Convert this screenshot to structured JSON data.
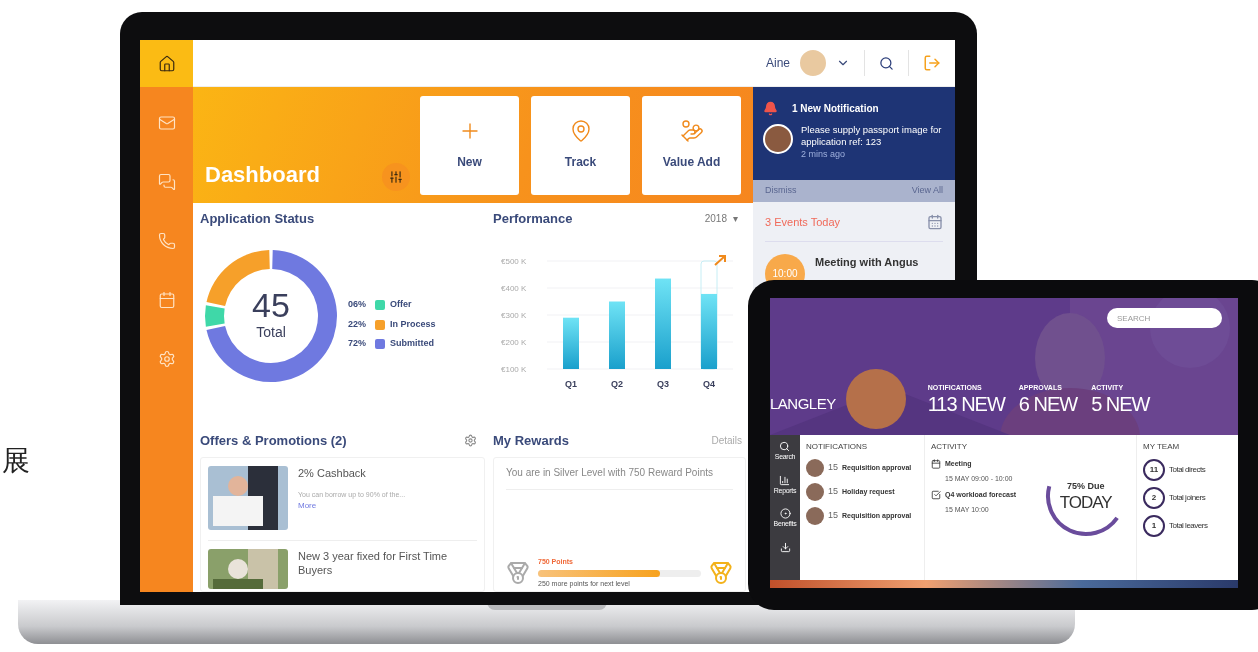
{
  "side_character": "展",
  "laptop": {
    "sidebar": [
      {
        "kind": "home",
        "selected": true
      },
      {
        "kind": "mail",
        "selected": false
      },
      {
        "kind": "chat",
        "selected": false
      },
      {
        "kind": "phone",
        "selected": false
      },
      {
        "kind": "calendar",
        "selected": false
      },
      {
        "kind": "settings",
        "selected": false
      }
    ],
    "topbar": {
      "user": "Aine"
    },
    "banner": {
      "title": "Dashboard",
      "tiles": [
        {
          "kind": "plus",
          "label": "New"
        },
        {
          "kind": "pin",
          "label": "Track"
        },
        {
          "kind": "hand",
          "label": "Value Add"
        }
      ]
    },
    "notification": {
      "heading": "1 New Notification",
      "message": "Please supply passport image for application ref: 123",
      "time": "2 mins ago",
      "actions": [
        "Dismiss",
        "View All"
      ]
    },
    "events": {
      "heading": "3 Events Today",
      "items": [
        {
          "time": "10:00",
          "title": "Meeting with Angus"
        }
      ]
    },
    "application_status": {
      "title": "Application Status",
      "total": "45",
      "total_label": "Total",
      "chart_data": {
        "type": "donut",
        "categories": [
          "Offer",
          "In Process",
          "Submitted"
        ],
        "values": [
          6,
          22,
          72
        ]
      },
      "legend": [
        {
          "percent": "06%",
          "color": "#3fd8a8"
        },
        {
          "percent": "22%",
          "color": "#f6a02a"
        },
        {
          "percent": "72%",
          "color": "#6f79e0"
        }
      ]
    },
    "performance": {
      "title": "Performance",
      "year": "2018",
      "year_caret": "▾",
      "chart_data": {
        "type": "bar",
        "categories": [
          "Q1",
          "Q2",
          "Q3",
          "Q4"
        ],
        "ylim": [
          100,
          500
        ],
        "grid": true,
        "series": [
          {
            "color": "#1aa0cc",
            "values": [
              290,
              350,
              435,
              378
            ]
          },
          {
            "color": "#c6eef5",
            "values": [
              null,
              null,
              null,
              500
            ]
          }
        ],
        "yticks": [
          {
            "value": 100,
            "label": "€100 K"
          },
          {
            "value": 200,
            "label": "€200 K"
          },
          {
            "value": 300,
            "label": "€300 K"
          },
          {
            "value": 400,
            "label": "€400 K"
          },
          {
            "value": 500,
            "label": "€500 K"
          }
        ]
      }
    },
    "offers": {
      "title": "Offers & Promotions (2)",
      "items": [
        {
          "title": "2% Cashback",
          "description": "You can borrow up to 90% of the...",
          "link": "More"
        },
        {
          "title": "New 3 year fixed for First Time Buyers"
        }
      ]
    },
    "rewards": {
      "title": "My Rewards",
      "link": "Details",
      "message": "You are in Silver Level with 750 Reward Points",
      "points": "750 Points",
      "level": 0.75,
      "note": "250 more points for next level"
    }
  },
  "tablet": {
    "search": {
      "placeholder": "SEARCH"
    },
    "user": "LANGLEY",
    "stats": [
      {
        "label": "NOTIFICATIONS",
        "value": "113 NEW"
      },
      {
        "label": "APPROVALS",
        "value": "6 NEW"
      },
      {
        "label": "ACTIVITY",
        "value": "5 NEW"
      }
    ],
    "nav": [
      {
        "kind": "search",
        "label": "Search"
      },
      {
        "kind": "reports",
        "label": "Reports"
      },
      {
        "kind": "benefits",
        "label": "Benefits"
      },
      {
        "kind": "download"
      }
    ],
    "notifications": {
      "title": "NOTIFICATIONS",
      "items": [
        {
          "day": "15",
          "title": "Requisition approval"
        },
        {
          "day": "15",
          "title": "Holiday request"
        },
        {
          "day": "15",
          "title": "Requisition approval"
        }
      ]
    },
    "activity": {
      "title": "ACTIVITY",
      "items": [
        {
          "kind": "calendar",
          "title": "Meeting",
          "time": "15 MAY 09:00 - 10:00"
        },
        {
          "kind": "check",
          "title": "Q4 workload forecast",
          "time": "15 MAY 10:00"
        }
      ],
      "due": "75% Due",
      "due_label": "TODAY"
    },
    "team": {
      "title": "MY TEAM",
      "items": [
        {
          "count": "11",
          "label": "Total directs"
        },
        {
          "count": "2",
          "label": "Total joiners"
        },
        {
          "count": "1",
          "label": "Total leavers"
        }
      ]
    }
  }
}
